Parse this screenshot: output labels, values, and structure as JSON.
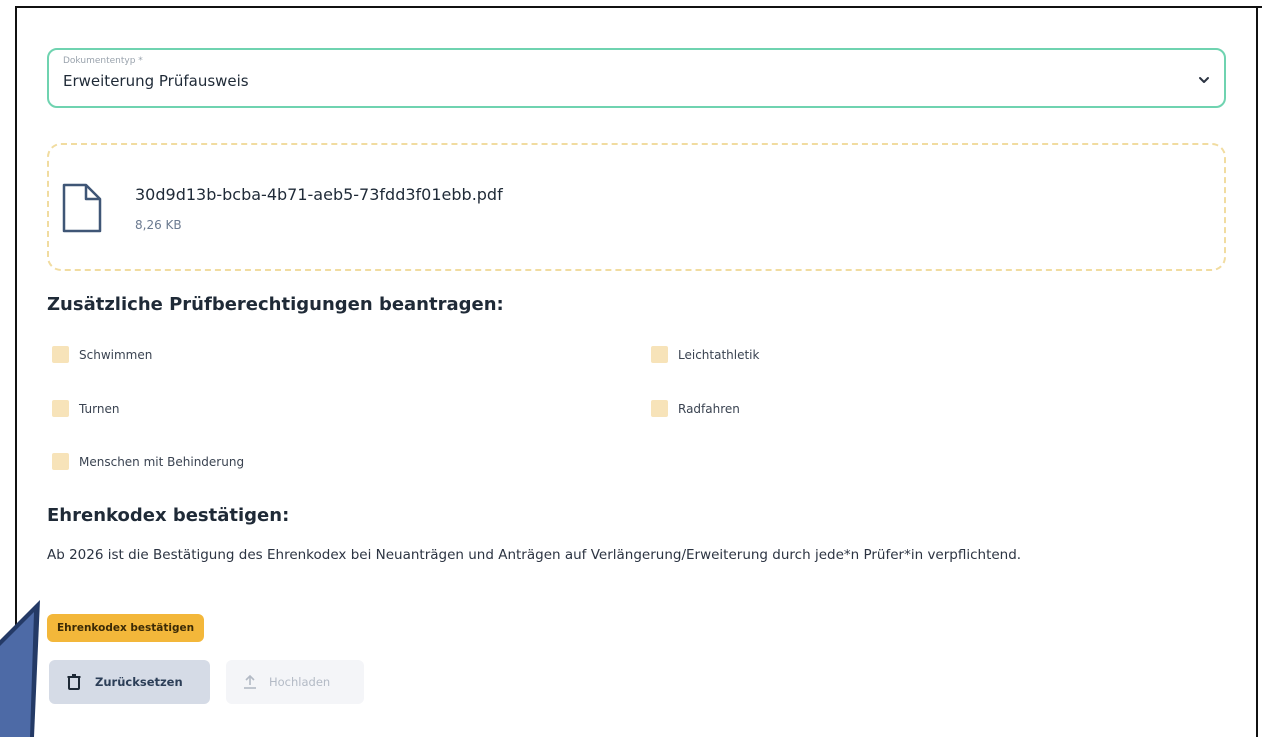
{
  "document_type": {
    "label": "Dokumententyp *",
    "value": "Erweiterung Prüfausweis",
    "icon": "chevron-down-icon"
  },
  "file": {
    "name": "30d9d13b-bcba-4b71-aeb5-73fdd3f01ebb.pdf",
    "size": "8,26 KB",
    "icon": "file-icon"
  },
  "permissions": {
    "title": "Zusätzliche Prüfberechtigungen beantragen:",
    "items": [
      {
        "label": "Schwimmen",
        "checked": false
      },
      {
        "label": "Leichtathletik",
        "checked": false
      },
      {
        "label": "Turnen",
        "checked": false
      },
      {
        "label": "Radfahren",
        "checked": false
      },
      {
        "label": "Menschen mit Behinderung",
        "checked": false
      }
    ]
  },
  "honor_code": {
    "title": "Ehrenkodex bestätigen:",
    "text": "Ab 2026 ist die Bestätigung des Ehrenkodex bei Neuanträgen und Anträgen auf Verlängerung/Erweiterung durch jede*n Prüfer*in verpflichtend.",
    "button_label": "Ehrenkodex bestätigen"
  },
  "actions": {
    "reset_label": "Zurücksetzen",
    "reset_icon": "trash-icon",
    "upload_label": "Hochladen",
    "upload_icon": "upload-icon"
  },
  "colors": {
    "select_border": "#6fd3b0",
    "dropzone_border": "#f1dca0",
    "checkbox": "#f7e3b9",
    "honor_button": "#f3b73a",
    "reset_button": "#d5dbe6",
    "upload_button": "#f4f5f8"
  }
}
